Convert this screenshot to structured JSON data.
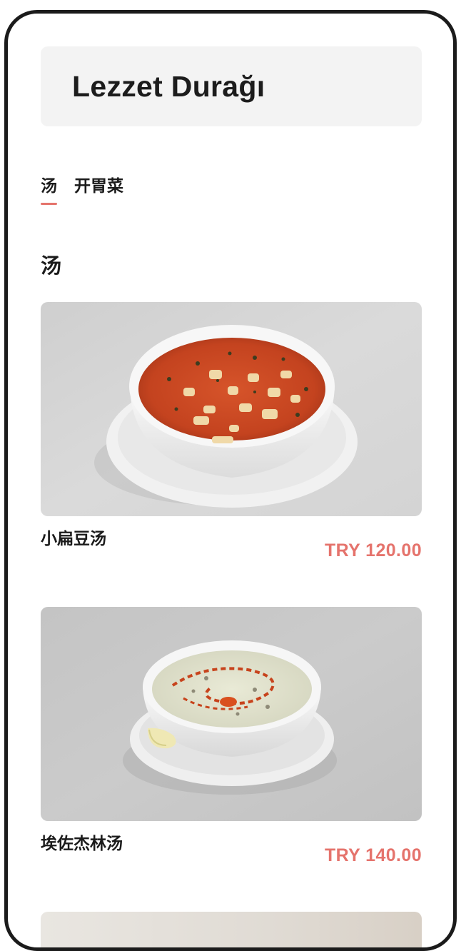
{
  "restaurant": {
    "name": "Lezzet Durağı"
  },
  "tabs": [
    {
      "label": "汤",
      "active": true
    },
    {
      "label": "开胃菜",
      "active": false
    }
  ],
  "section": {
    "title": "汤"
  },
  "items": [
    {
      "name": "小扁豆汤",
      "price": "TRY 120.00",
      "image": "red-lentil-soup-image"
    },
    {
      "name": "埃佐杰林汤",
      "price": "TRY 140.00",
      "image": "yogurt-soup-image"
    }
  ],
  "colors": {
    "accent": "#e5736c",
    "frame": "#1b1b1b",
    "header_bg": "#f3f3f3"
  }
}
